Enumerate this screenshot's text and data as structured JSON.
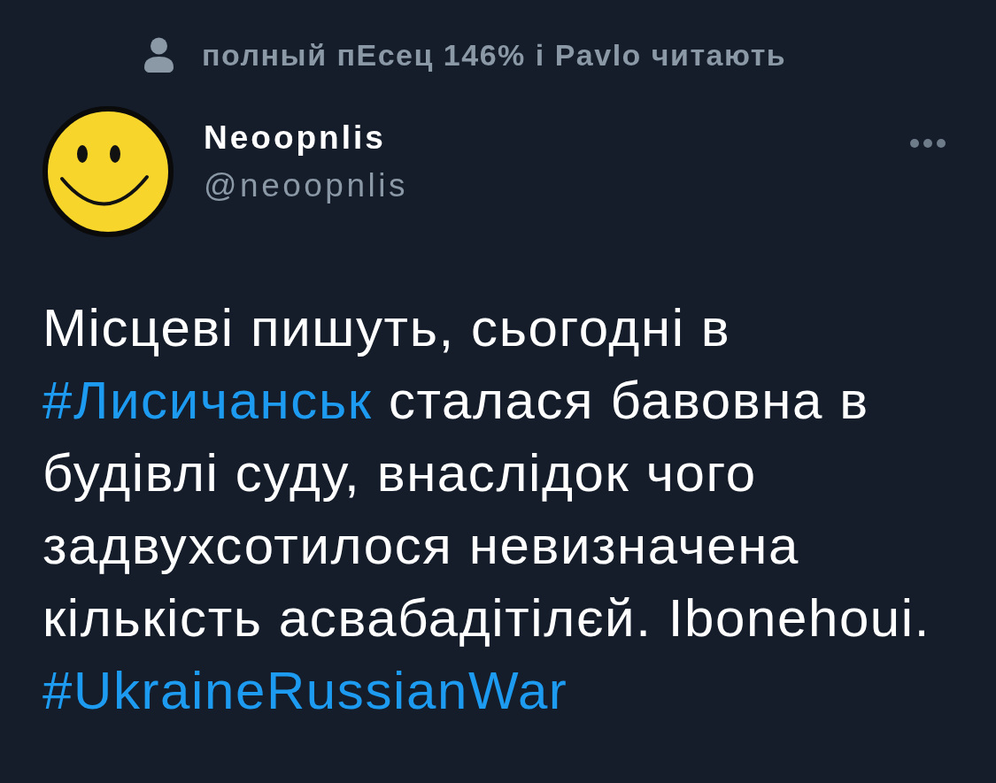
{
  "social_context": {
    "text": "полный пЕсец 146% і Pavlo читають"
  },
  "author": {
    "name": "Neoopnlis",
    "handle": "@neoopnlis"
  },
  "tweet": {
    "lines": [
      [
        {
          "kind": "text",
          "text": "Місцеві пишуть, сьогодні в"
        }
      ],
      [
        {
          "kind": "hashtag",
          "text": "#Лисичанськ"
        },
        {
          "kind": "text",
          "text": " сталася бавовна в"
        }
      ],
      [
        {
          "kind": "text",
          "text": "будівлі суду, внаслідок чого"
        }
      ],
      [
        {
          "kind": "text",
          "text": "задвухсотилося невизначена"
        }
      ],
      [
        {
          "kind": "text",
          "text": "кількість асвабадітілєй. Ibonehoui."
        }
      ],
      [
        {
          "kind": "hashtag",
          "text": "#UkraineRussianWar"
        }
      ]
    ]
  }
}
